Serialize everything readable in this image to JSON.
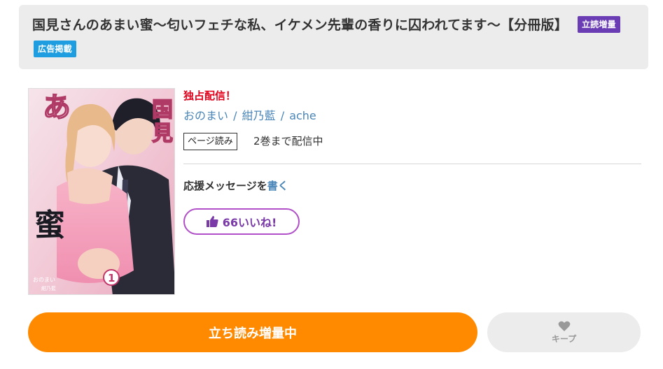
{
  "book": {
    "title": "国見さんのあまい蜜～匂いフェチな私、イケメン先輩の香りに囚われてます～【分冊版】",
    "badges": [
      "立読増量",
      "広告掲載"
    ],
    "cover_alt": "国見さんのあまい蜜 第1巻 表紙",
    "cover_text": {
      "title_vertical": "国見さんのあまい蜜",
      "subtitle": "匂いフェチな私、イケメン先輩の香りに囚われてます",
      "volume": "1",
      "credits": "おのまい 紺乃藍"
    }
  },
  "info": {
    "exclusive": "独占配信！",
    "authors": [
      "おのまい",
      "紺乃藍",
      "ache"
    ],
    "author_separator": "/",
    "format_tag": "ページ読み",
    "volumes_status": "2巻まで配信中",
    "support_prefix": "応援メッセージを",
    "support_link": "書く",
    "like_label": "66いいね!"
  },
  "actions": {
    "read_label": "立ち読み増量中",
    "keep_label": "キープ"
  },
  "colors": {
    "accent_orange": "#ff8a00",
    "exclusive_red": "#e3001b",
    "link_blue": "#4a86b8",
    "badge_purple": "#6a3db4",
    "badge_blue": "#1e9ee0",
    "like_purple": "#b04fc8"
  }
}
